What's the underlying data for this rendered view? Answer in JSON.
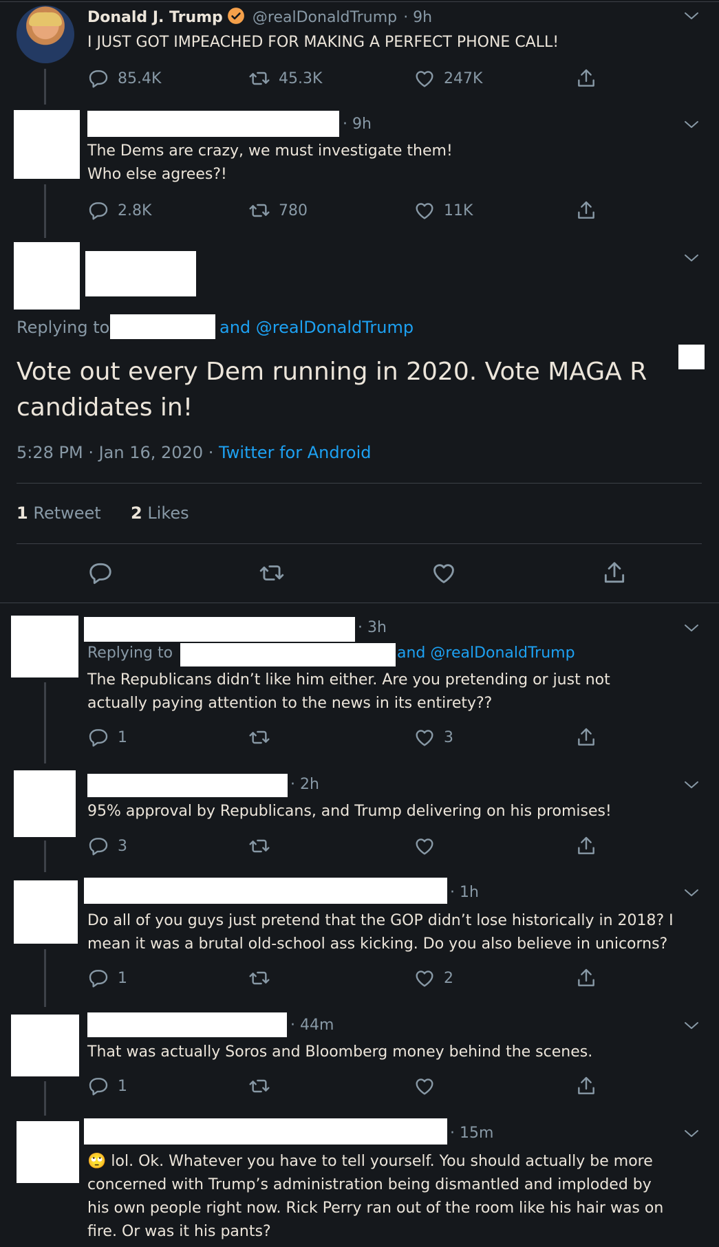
{
  "tweet1": {
    "name": "Donald J. Trump",
    "handle": "@realDonaldTrump",
    "time": "· 9h",
    "text": "I JUST GOT IMPEACHED FOR MAKING A PERFECT PHONE CALL!",
    "replies": "85.4K",
    "retweets": "45.3K",
    "likes": "247K"
  },
  "tweet2": {
    "time": "· 9h",
    "text_line1": "The Dems are crazy, we must investigate them!",
    "text_line2": "Who else agrees?!",
    "replies": "2.8K",
    "retweets": "780",
    "likes": "11K"
  },
  "main_tweet": {
    "replying_to": "Replying to",
    "and_handle": "and @realDonaldTrump",
    "text_line1": "Vote out every Dem running in 2020. Vote MAGA R",
    "text_line2": "candidates in!",
    "timestamp": "5:28 PM · Jan 16, 2020 ·",
    "source": "Twitter for Android",
    "retweet_count": "1",
    "retweet_label": "Retweet",
    "like_count": "2",
    "like_label": "Likes"
  },
  "replies": [
    {
      "time": "· 3h",
      "replying_to": "Replying to",
      "and_handle": "and @realDonaldTrump",
      "text_line1": "The Republicans didn’t like him either. Are you pretending or just not",
      "text_line2": "actually paying attention to the news in its entirety??",
      "replies": "1",
      "retweets": "",
      "likes": "3"
    },
    {
      "time": "· 2h",
      "text_line1": "95% approval by Republicans, and Trump delivering on his promises!",
      "replies": "3",
      "retweets": "",
      "likes": ""
    },
    {
      "time": "· 1h",
      "text_line1": "Do all of you guys just pretend that the GOP didn’t lose historically in 2018? I",
      "text_line2": "mean it was a brutal old-school ass kicking. Do you also believe in unicorns?",
      "replies": "1",
      "retweets": "",
      "likes": "2"
    },
    {
      "time": "· 44m",
      "text_line1": "That was actually Soros and Bloomberg money behind the scenes.",
      "replies": "1",
      "retweets": "",
      "likes": ""
    },
    {
      "time": "· 15m",
      "emoji": "🙄",
      "text_line1": "lol. Ok. Whatever you have to tell yourself. You should actually be more",
      "text_line2": "concerned with Trump’s administration being dismantled and imploded by",
      "text_line3": "his own people right now. Rick Perry ran out of the room like his hair was on",
      "text_line4": "fire. Or was it his pants?"
    }
  ],
  "colors": {
    "background": "#15181c",
    "text": "#ece5da",
    "muted": "#8899a6",
    "link": "#1da1f2",
    "verified": "#f5a04a"
  }
}
